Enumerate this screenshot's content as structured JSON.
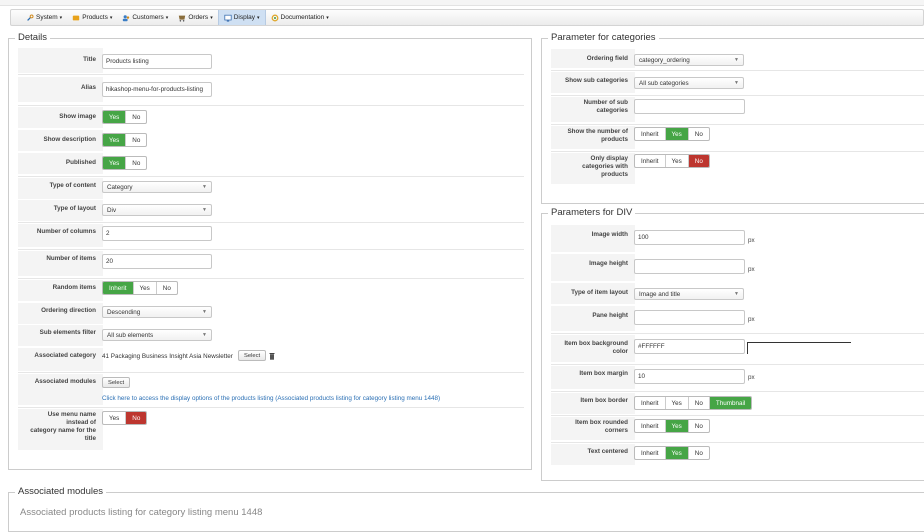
{
  "menu": {
    "items": [
      {
        "label": "System",
        "icon": "wrench-icon"
      },
      {
        "label": "Products",
        "icon": "products-icon"
      },
      {
        "label": "Customers",
        "icon": "customers-icon"
      },
      {
        "label": "Orders",
        "icon": "orders-icon"
      },
      {
        "label": "Display",
        "icon": "display-icon"
      },
      {
        "label": "Documentation",
        "icon": "documentation-icon"
      }
    ]
  },
  "details": {
    "legend": "Details",
    "title_label": "Title",
    "title_value": "Products listing",
    "alias_label": "Alias",
    "alias_value": "hikashop-menu-for-products-listing",
    "show_image_label": "Show image",
    "show_description_label": "Show description",
    "published_label": "Published",
    "yes": "Yes",
    "no": "No",
    "inherit": "Inherit",
    "type_content_label": "Type of content",
    "type_content_value": "Category",
    "type_layout_label": "Type of layout",
    "type_layout_value": "Div",
    "columns_label": "Number of columns",
    "columns_value": "2",
    "items_label": "Number of items",
    "items_value": "20",
    "random_label": "Random items",
    "ordering_dir_label": "Ordering direction",
    "ordering_dir_value": "Descending",
    "sub_filter_label": "Sub elements filter",
    "sub_filter_value": "All sub elements",
    "assoc_cat_label": "Associated category",
    "assoc_cat_value": "41 Packaging Business Insight Asia Newsletter",
    "select_label": "Select",
    "assoc_modules_label": "Associated modules",
    "modules_link": "Click here to access the display options of the products listing (Associated products listing for category listing menu 1448)",
    "use_menu_label_1": "Use menu name",
    "use_menu_label_2": "instead of",
    "use_menu_label_3": "category name for the",
    "use_menu_label_4": "title"
  },
  "categories": {
    "legend": "Parameter for categories",
    "ordering_label": "Ordering field",
    "ordering_value": "category_ordering",
    "show_sub_label": "Show sub categories",
    "show_sub_value": "All sub categories",
    "num_sub_label_1": "Number of sub",
    "num_sub_label_2": "categories",
    "show_num_label_1": "Show the number of",
    "show_num_label_2": "products",
    "only_display_label_1": "Only display",
    "only_display_label_2": "categories with",
    "only_display_label_3": "products"
  },
  "div": {
    "legend": "Parameters for DIV",
    "img_width_label": "Image width",
    "img_width_value": "100",
    "img_height_label": "Image height",
    "item_layout_label": "Type of item layout",
    "item_layout_value": "Image and title",
    "pane_height_label": "Pane height",
    "bg_color_label_1": "Item box background",
    "bg_color_label_2": "color",
    "bg_color_value": "#FFFFFF",
    "margin_label": "Item box margin",
    "margin_value": "10",
    "border_label": "Item box border",
    "thumbnail": "Thumbnail",
    "rounded_label_1": "Item box rounded",
    "rounded_label_2": "corners",
    "centered_label": "Text centered",
    "px": "px"
  },
  "assoc": {
    "legend": "Associated modules",
    "sub": "Associated products listing for category listing menu 1448"
  },
  "colors": {
    "green": "#46a546",
    "red": "#bd362f",
    "link": "#2a6fb4",
    "active_menu": "#cfe0f3"
  }
}
